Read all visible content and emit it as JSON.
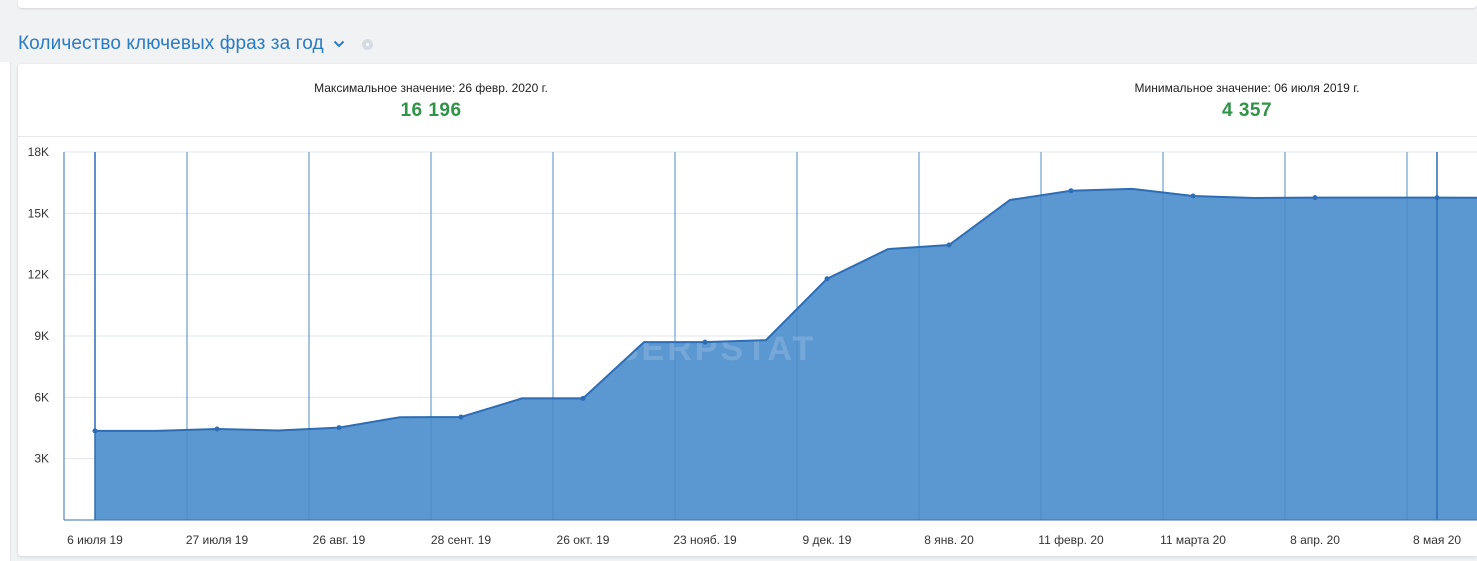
{
  "section": {
    "title": "Количество ключевых фраз за год"
  },
  "stats": {
    "max_label": "Максимальное значение: 26 февр. 2020 г.",
    "max_value": "16 196",
    "min_label": "Минимальное значение: 06 июля 2019 г.",
    "min_value": "4 357"
  },
  "watermark": "SERPSTAT",
  "colors": {
    "title": "#2a7bc6",
    "stat_value": "#2f9447",
    "area_fill": "#5b98d1",
    "line": "#2d6db5"
  },
  "chart_data": {
    "type": "area",
    "ylim": [
      0,
      18000
    ],
    "yticks": [
      3000,
      6000,
      9000,
      12000,
      15000,
      18000
    ],
    "ytick_labels": [
      "3K",
      "6K",
      "9K",
      "12K",
      "15K",
      "18K"
    ],
    "xtick_labels": [
      "6 июля 19",
      "27 июля 19",
      "26 авг. 19",
      "28 сент. 19",
      "26 окт. 19",
      "23 нояб. 19",
      "9 дек. 19",
      "8 янв. 20",
      "11 февр. 20",
      "11 марта 20",
      "8 апр. 20",
      "8 мая 20"
    ],
    "values": [
      4357,
      4360,
      4450,
      4380,
      4520,
      5030,
      5040,
      5950,
      5950,
      8700,
      8700,
      8800,
      11800,
      13250,
      13450,
      15650,
      16100,
      16196,
      15850,
      15750,
      15770,
      15770,
      15770,
      15760
    ],
    "markers": [
      0,
      2,
      4,
      6,
      8,
      10,
      12,
      14,
      16,
      18,
      20,
      22
    ],
    "grid": true,
    "legend": "none"
  }
}
